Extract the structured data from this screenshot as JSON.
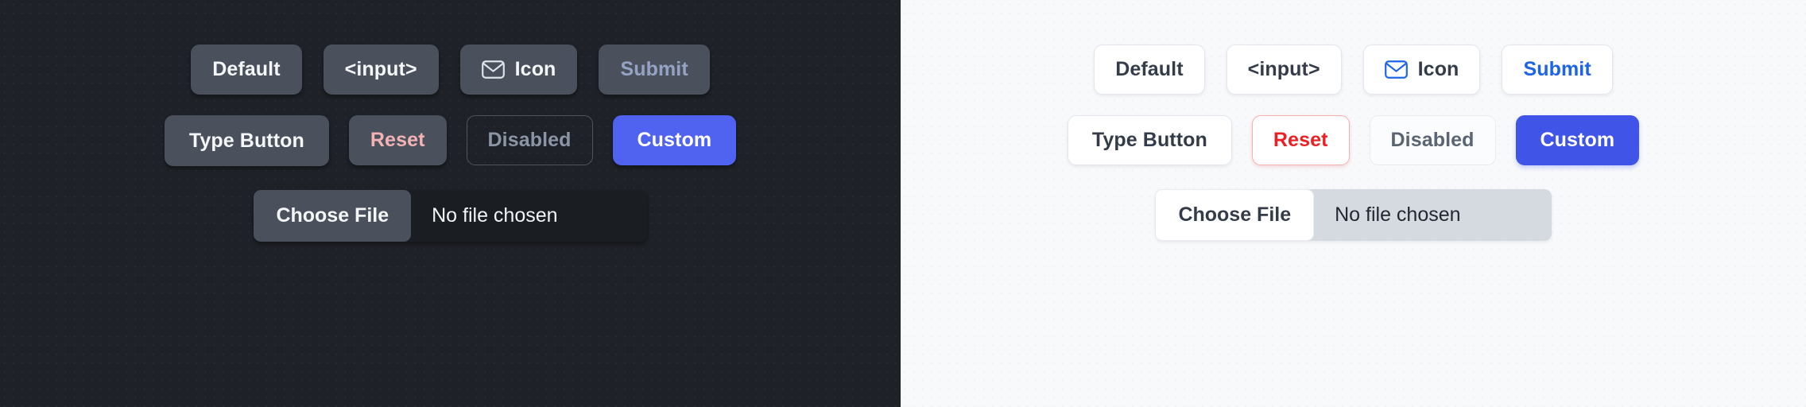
{
  "panes": {
    "dark": {
      "theme_name": "dark",
      "background_color": "#1e2127",
      "rows": [
        {
          "buttons": [
            {
              "label": "Default",
              "variant": "default"
            },
            {
              "label": "<input>",
              "variant": "default"
            },
            {
              "label": "Icon",
              "variant": "icon",
              "icon": "envelope-icon"
            },
            {
              "label": "Submit",
              "variant": "submit",
              "text_color": "#94a3c4"
            }
          ]
        },
        {
          "buttons": [
            {
              "label": "Type Button",
              "variant": "typebutton"
            },
            {
              "label": "Reset",
              "variant": "reset",
              "text_color": "#f3b3b5"
            },
            {
              "label": "Disabled",
              "variant": "disabled",
              "text_color": "#8b95a6"
            },
            {
              "label": "Custom",
              "variant": "custom",
              "background_color": "#4f63f0",
              "text_color": "#ffffff"
            }
          ]
        }
      ],
      "file_input": {
        "button_label": "Choose File",
        "file_name": "No file chosen"
      }
    },
    "light": {
      "theme_name": "light",
      "background_color": "#f8f9fb",
      "rows": [
        {
          "buttons": [
            {
              "label": "Default",
              "variant": "default"
            },
            {
              "label": "<input>",
              "variant": "default"
            },
            {
              "label": "Icon",
              "variant": "icon",
              "icon": "envelope-icon"
            },
            {
              "label": "Submit",
              "variant": "submit",
              "text_color": "#1d64e8"
            }
          ]
        },
        {
          "buttons": [
            {
              "label": "Type Button",
              "variant": "typebutton"
            },
            {
              "label": "Reset",
              "variant": "reset",
              "text_color": "#ee1f22",
              "border_color": "#f6b0b2"
            },
            {
              "label": "Disabled",
              "variant": "disabled",
              "text_color": "#5a6472"
            },
            {
              "label": "Custom",
              "variant": "custom",
              "background_color": "#4055e8",
              "text_color": "#ffffff"
            }
          ]
        }
      ],
      "file_input": {
        "button_label": "Choose File",
        "file_name": "No file chosen"
      }
    }
  }
}
